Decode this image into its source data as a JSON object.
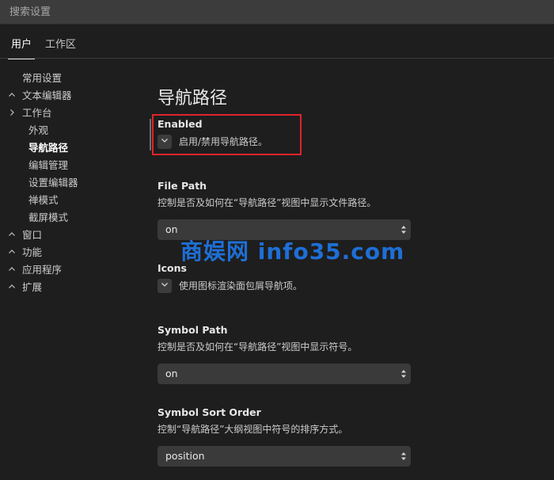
{
  "search": {
    "placeholder": "搜索设置"
  },
  "tabs": [
    {
      "label": "用户"
    },
    {
      "label": "工作区"
    }
  ],
  "toc": [
    {
      "label": "常用设置",
      "chevron": ""
    },
    {
      "label": "文本编辑器",
      "chevron": "chevron-up-icon"
    },
    {
      "label": "工作台",
      "chevron": "chevron-right-icon"
    },
    {
      "label": "外观",
      "chevron": ""
    },
    {
      "label": "导航路径",
      "chevron": "",
      "active": true
    },
    {
      "label": "编辑管理",
      "chevron": ""
    },
    {
      "label": "设置编辑器",
      "chevron": ""
    },
    {
      "label": "禅模式",
      "chevron": ""
    },
    {
      "label": "截屏模式",
      "chevron": ""
    },
    {
      "label": "窗口",
      "chevron": "chevron-up-icon"
    },
    {
      "label": "功能",
      "chevron": "chevron-up-icon"
    },
    {
      "label": "应用程序",
      "chevron": "chevron-up-icon"
    },
    {
      "label": "扩展",
      "chevron": "chevron-up-icon"
    }
  ],
  "section": {
    "title": "导航路径"
  },
  "settings": {
    "enabled": {
      "title": "Enabled",
      "checkbox_label": "启用/禁用导航路径。"
    },
    "file_path": {
      "title": "File Path",
      "description": "控制是否及如何在“导航路径”视图中显示文件路径。",
      "value": "on"
    },
    "icons": {
      "title": "Icons",
      "checkbox_label": "使用图标渲染面包屑导航项。"
    },
    "symbol_path": {
      "title": "Symbol Path",
      "description": "控制是否及如何在“导航路径”视图中显示符号。",
      "value": "on"
    },
    "symbol_sort_order": {
      "title": "Symbol Sort Order",
      "description": "控制“导航路径”大纲视图中符号的排序方式。",
      "value": "position"
    }
  },
  "watermark": {
    "text": "商娱网 info35.com"
  },
  "colors": {
    "background": "#1e1e1e",
    "highlight": "#e0242b",
    "watermark": "#1e6fd6"
  }
}
